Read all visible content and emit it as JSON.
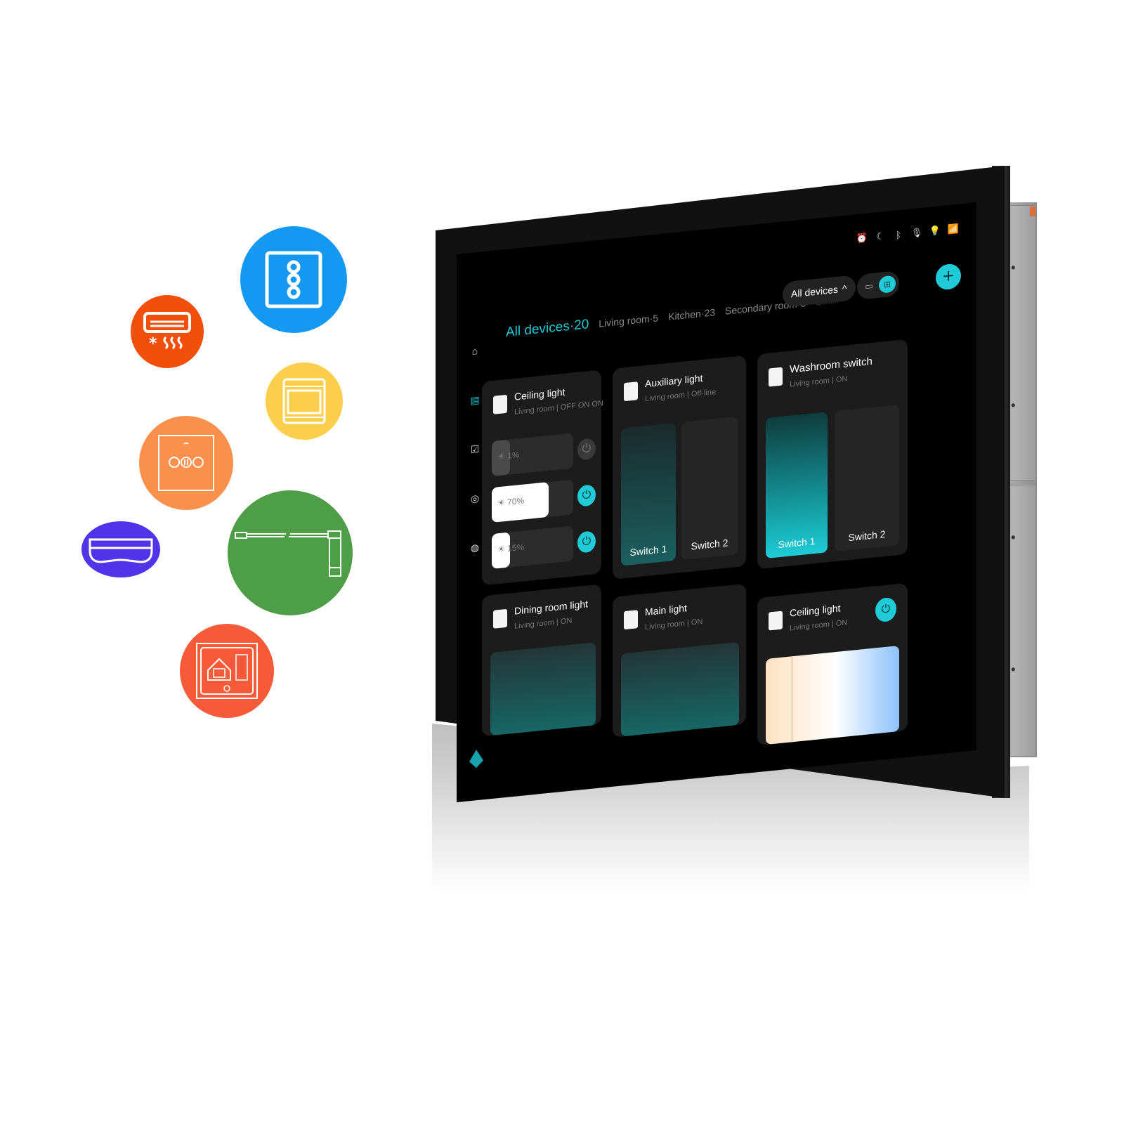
{
  "device_bubbles": [
    {
      "name": "smart-switch",
      "icon": "three-button-switch-icon",
      "color": "#1399f2"
    },
    {
      "name": "air-conditioner",
      "icon": "air-conditioner-icon",
      "color": "#f24e0c"
    },
    {
      "name": "oven",
      "icon": "oven-icon",
      "color": "#fcce4c"
    },
    {
      "name": "curtain-switch",
      "icon": "curtain-switch-icon",
      "color": "#fb8f4c"
    },
    {
      "name": "ir-hub",
      "icon": "ir-hub-icon",
      "color": "#5133ea"
    },
    {
      "name": "curtain-motor",
      "icon": "curtain-rail-icon",
      "color": "#4e9d47"
    },
    {
      "name": "thermostat",
      "icon": "thermostat-icon",
      "color": "#f75a38"
    }
  ],
  "status_bar": {
    "icons": [
      "alarm-icon",
      "moon-icon",
      "bluetooth-icon",
      "mic-off-icon",
      "bulb-icon",
      "wifi-icon"
    ]
  },
  "nav": {
    "items": [
      {
        "name": "home",
        "icon": "home-icon",
        "active": false
      },
      {
        "name": "devices",
        "icon": "devices-icon",
        "active": true
      },
      {
        "name": "scenes",
        "icon": "checkbox-icon",
        "active": false
      },
      {
        "name": "camera",
        "icon": "camera-icon",
        "active": false
      },
      {
        "name": "settings",
        "icon": "power-cycle-icon",
        "active": false
      }
    ]
  },
  "header": {
    "tabs": [
      {
        "label": "All devices·20",
        "active": true
      },
      {
        "label": "Living room·5",
        "active": false
      },
      {
        "label": "Kitchen·23",
        "active": false
      },
      {
        "label": "Secondary room·3",
        "active": false
      },
      {
        "label": "Dinin",
        "active": false
      }
    ],
    "filter_label": "All devices",
    "filter_chevron": "^",
    "add_label": "+",
    "accent": "#1ecbd6"
  },
  "cards": [
    {
      "title": "Ceiling light",
      "subtitle": "Living room | OFF ON ON",
      "sliders": [
        {
          "label": "☀ 1%",
          "value": 0.22,
          "on": false
        },
        {
          "label": "☀ 70%",
          "value": 0.7,
          "on": true
        },
        {
          "label": "☀ 15%",
          "value": 0.22,
          "on": true
        }
      ]
    },
    {
      "title": "Auxiliary light",
      "subtitle": "Living room | Off-line",
      "switches": [
        {
          "label": "Switch 1",
          "on": true
        },
        {
          "label": "Switch 2",
          "on": false
        }
      ]
    },
    {
      "title": "Washroom switch",
      "subtitle": "Living room | ON",
      "switches": [
        {
          "label": "Switch 1",
          "on": true
        },
        {
          "label": "Switch 2",
          "on": false
        }
      ]
    },
    {
      "title": "Dining room light",
      "subtitle": "Living room | ON"
    },
    {
      "title": "Main light",
      "subtitle": "Living room | ON"
    },
    {
      "title": "Ceiling light",
      "subtitle": "Living room | ON",
      "power": true
    }
  ],
  "side_module": {
    "dots": "•••"
  }
}
